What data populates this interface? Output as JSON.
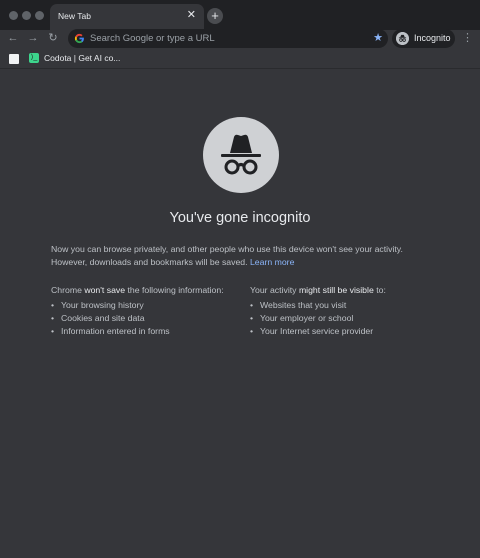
{
  "tab": {
    "title": "New Tab",
    "close_glyph": "✕",
    "new_tab_glyph": "+"
  },
  "toolbar": {
    "back_glyph": "←",
    "forward_glyph": "→",
    "reload_glyph": "↻",
    "omnibox_placeholder": "Search Google or type a URL",
    "star_glyph": "★",
    "profile_label": "Incognito",
    "menu_glyph": "⋮"
  },
  "bookmarks": {
    "items": [
      {
        "label": "Codota | Get AI co...",
        "favicon_glyph": "⟩_"
      }
    ]
  },
  "page": {
    "heading": "You've gone incognito",
    "intro": "Now you can browse privately, and other people who use this device won't see your activity. However, downloads and bookmarks will be saved.",
    "learn_more": "Learn more",
    "left_column": {
      "head_prefix": "Chrome ",
      "head_strong": "won't save",
      "head_suffix": " the following information:",
      "items": [
        "Your browsing history",
        "Cookies and site data",
        "Information entered in forms"
      ]
    },
    "right_column": {
      "head_prefix": "Your activity ",
      "head_strong": "might still be visible",
      "head_suffix": " to:",
      "items": [
        "Websites that you visit",
        "Your employer or school",
        "Your Internet service provider"
      ]
    }
  },
  "colors": {
    "frame": "#202124",
    "background": "#35363a",
    "text": "#e8eaed",
    "secondary_text": "#bdc1c6",
    "link": "#8ab4f8",
    "bookmark_favicon": "#3dd58d"
  },
  "icons": [
    "back-icon",
    "forward-icon",
    "reload-icon",
    "google-icon",
    "star-icon",
    "incognito-icon",
    "menu-icon"
  ]
}
